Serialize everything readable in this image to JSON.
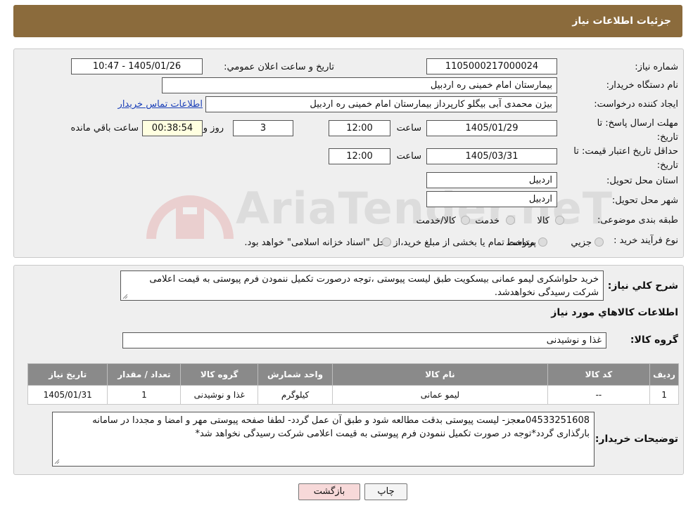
{
  "header": {
    "title": "جزئیات اطلاعات نیاز"
  },
  "form": {
    "need_number_label": "شماره نیاز:",
    "need_number": "1105000217000024",
    "announce_label": "تاریخ و ساعت اعلان عمومي:",
    "announce_value": "1405/01/26 - 10:47",
    "buyer_org_label": "نام دستگاه خريدار:",
    "buyer_org": "بیمارستان امام خمینی  ره  اردبیل",
    "requester_label": "ايجاد کننده درخواست:",
    "requester": "بیژن محمدی آبی بیگلو کارپرداز بیمارستان امام خمینی  ره  اردبیل",
    "contact_link": "اطلاعات تماس خریدار",
    "send_deadline_label": "مهلت ارسال پاسخ: تا تاریخ:",
    "send_date": "1405/01/29",
    "time_label": "ساعت",
    "send_time": "12:00",
    "days": "3",
    "days_label": "روز و",
    "remaining": "00:38:54",
    "remaining_label": "ساعت باقي مانده",
    "price_validity_label": "حداقل تاريخ اعتبار قيمت: تا تاریخ:",
    "price_date": "1405/03/31",
    "price_time": "12:00",
    "province_label": "استان محل تحويل:",
    "province": "اردبیل",
    "city_label": "شهر محل تحويل:",
    "city": "اردبیل",
    "category_label": "طبقه بندی موضوعی:",
    "category_options": [
      "کالا",
      "خدمت",
      "کالا/خدمت"
    ],
    "process_label": "نوع فرآيند خريد :",
    "process_options": [
      "جزيي",
      "متوسط"
    ],
    "process_note": "پرداخت تمام یا بخشی از مبلغ خرید،از محل \"اسناد خزانه اسلامی\" خواهد بود."
  },
  "description": {
    "label": "شرح کلي نياز:",
    "text": "خرید حلواشکری لیمو عمانی بیسکویت طبق لیست پیوستی ،توجه درصورت تکمیل ننمودن فرم پیوستی به قیمت اعلامی شرکت رسیدگی نخواهدشد."
  },
  "goods": {
    "section_title": "اطلاعات کالاهاي مورد نياز",
    "group_label": "گروه کالا:",
    "group_value": "غذا و نوشیدنی",
    "columns": [
      "رديف",
      "کد کالا",
      "نام کالا",
      "واحد شمارش",
      "گروه کالا",
      "تعداد / مقدار",
      "تاریخ نیاز"
    ],
    "rows": [
      [
        "1",
        "--",
        "لیمو عمانی",
        "کیلوگرم",
        "غذا و نوشیدنی",
        "1",
        "1405/01/31"
      ]
    ]
  },
  "buyer_notes": {
    "label": "توضيحات خريدار:",
    "text": "04533251608معجز- لیست پیوستی بدقت مطالعه شود و طبق آن عمل گردد- لطفا صفحه پیوستی مهر و امضا و مجددا در سامانه بارگذاری گردد*توجه در صورت تکمیل ننمودن فرم پیوستی به قیمت اعلامی شرکت رسیدگی نخواهد شد*"
  },
  "buttons": {
    "print": "چاپ",
    "back": "بازگشت"
  },
  "watermark": {
    "text": "AriaTender.neT"
  },
  "colors": {
    "header": "#8b6b3c",
    "table_header": "#8a8a8a",
    "link": "#1a3fb8",
    "back_button": "#f7d9d9"
  }
}
